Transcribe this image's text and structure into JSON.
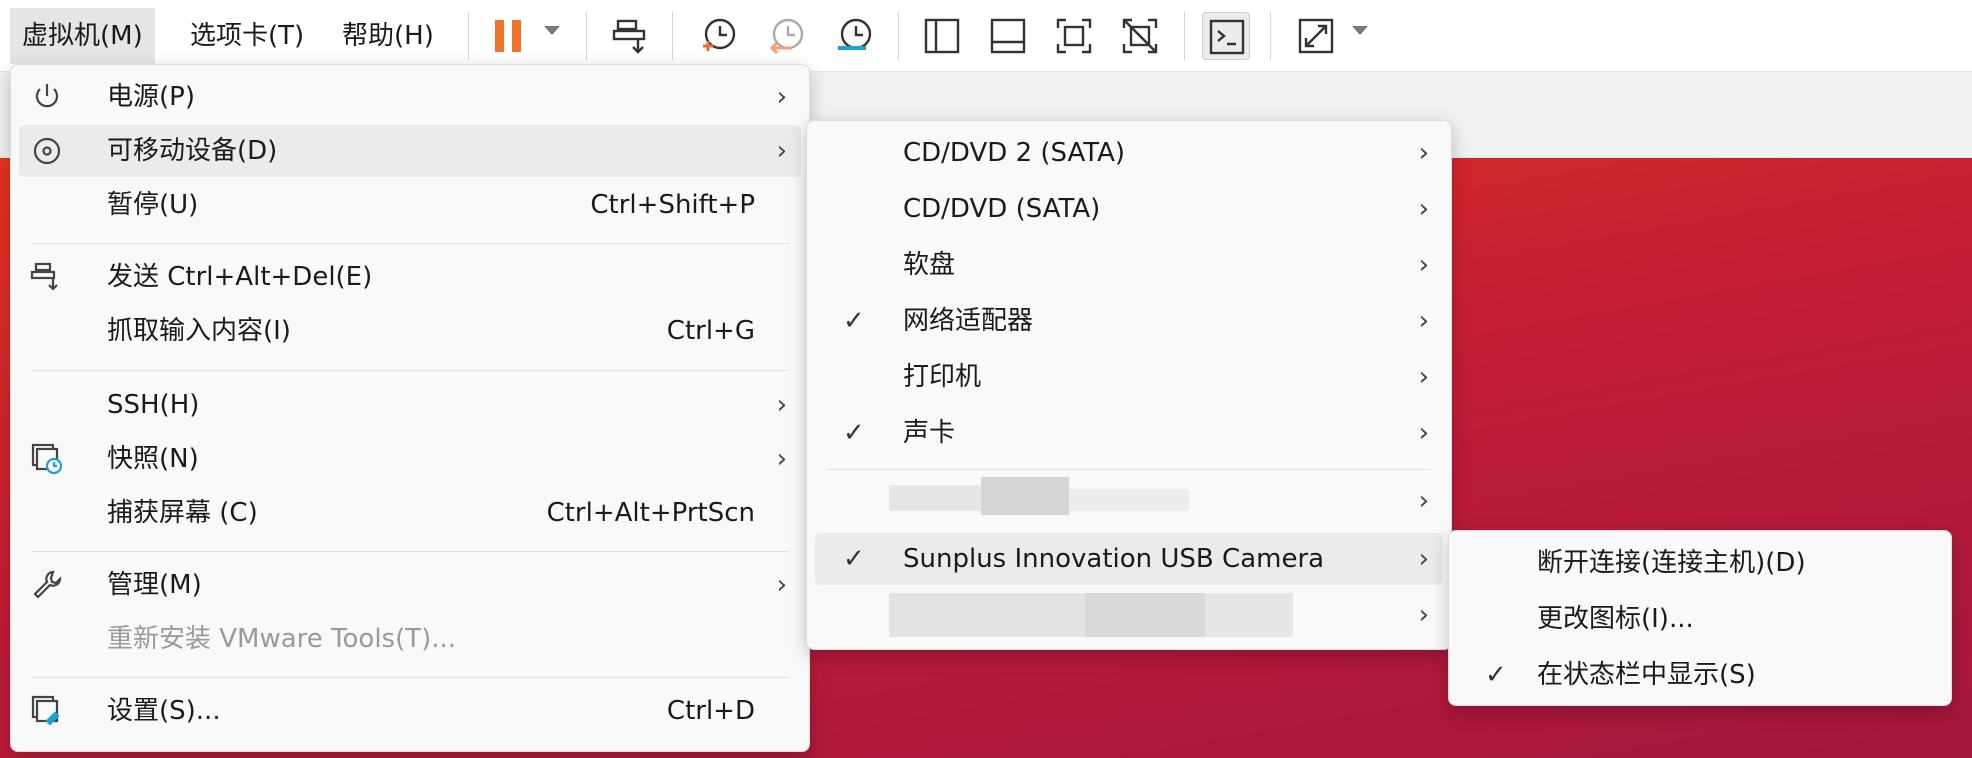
{
  "menubar": {
    "vm": "虚拟机(M)",
    "tabs": "选项卡(T)",
    "help": "帮助(H)"
  },
  "toolbar_icons": [
    "pause-icon",
    "send-ctrl-alt-del-icon",
    "snapshot-take-icon",
    "snapshot-revert-icon",
    "snapshot-manager-icon",
    "library-view-icon",
    "thumbnail-view-icon",
    "fullscreen-icon",
    "unity-icon",
    "console-icon",
    "stretch-icon"
  ],
  "colors": {
    "pause": "#f07327",
    "revert": "#f3a07a",
    "manager": "#1aa3d9",
    "snapshot_badge": "#e9702c",
    "vm_bg": "#c41d35"
  },
  "vm_menu": {
    "power": {
      "label": "电源(P)",
      "icon": "power-icon"
    },
    "removable": {
      "label": "可移动设备(D)",
      "icon": "disc-icon"
    },
    "pause": {
      "label": "暂停(U)",
      "shortcut": "Ctrl+Shift+P"
    },
    "send_cad": {
      "label": "发送 Ctrl+Alt+Del(E)",
      "icon": "send-keys-icon"
    },
    "grab_input": {
      "label": "抓取输入内容(I)",
      "shortcut": "Ctrl+G"
    },
    "ssh": {
      "label": "SSH(H)"
    },
    "snapshot": {
      "label": "快照(N)",
      "icon": "snapshot-icon"
    },
    "capture": {
      "label": "捕获屏幕 (C)",
      "shortcut": "Ctrl+Alt+PrtScn"
    },
    "manage": {
      "label": "管理(M)",
      "icon": "wrench-icon"
    },
    "reinstall": {
      "label": "重新安装 VMware Tools(T)..."
    },
    "settings": {
      "label": "设置(S)...",
      "shortcut": "Ctrl+D",
      "icon": "settings-icon"
    }
  },
  "devices_menu": {
    "cd2": {
      "label": "CD/DVD 2 (SATA)"
    },
    "cd": {
      "label": "CD/DVD (SATA)"
    },
    "floppy": {
      "label": "软盘"
    },
    "network": {
      "label": "网络适配器",
      "checked": "✓"
    },
    "printer": {
      "label": "打印机"
    },
    "sound": {
      "label": "声卡",
      "checked": "✓"
    },
    "camera": {
      "label": "Sunplus Innovation USB Camera",
      "checked": "✓"
    }
  },
  "camera_menu": {
    "disconnect": {
      "label": "断开连接(连接主机)(D)"
    },
    "change_icon": {
      "label": "更改图标(I)..."
    },
    "show_status": {
      "label": "在状态栏中显示(S)",
      "checked": "✓"
    }
  },
  "glyphs": {
    "arrow": "›"
  }
}
